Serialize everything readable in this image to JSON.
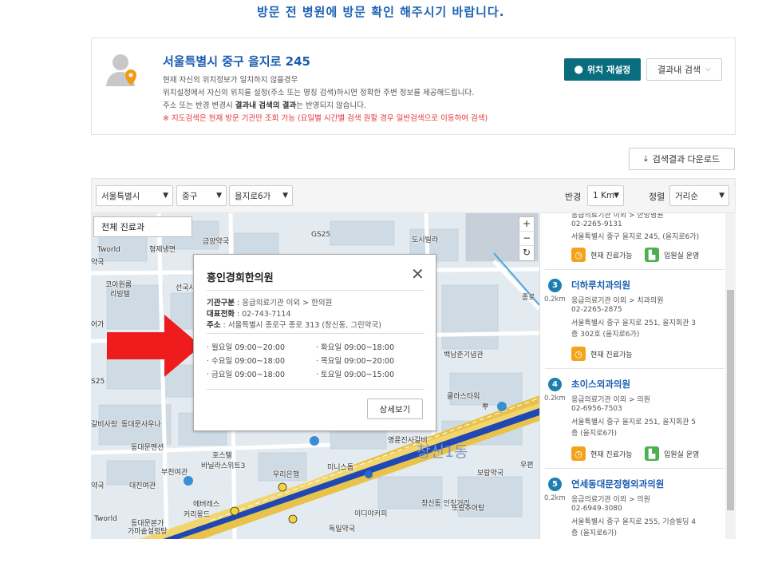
{
  "banner": {
    "text": "방문 전 병원에 방문 확인 해주시기 바랍니다."
  },
  "location": {
    "address": "서울특별시 중구 을지로 245",
    "line1": "현재 자신의 위치정보가 일치하지 않을경우",
    "line2": "위치설정에서 자신의 위치를 설정(주소 또는 명칭 검색)하시면 정확한 주변 정보를 제공해드립니다.",
    "line3_pre": "주소 또는 반경 변경시 ",
    "line3_bold": "결과내 검색의 결과",
    "line3_post": "는 반영되지 않습니다.",
    "warning": "※ 지도검색은 현재 방문 기관만 조회 가능 (요일별 시간별 검색 원할 경우 일반검색으로 이동하여 검색)",
    "reset_label": "위치 재설정",
    "search_within_label": "결과내 검색"
  },
  "download_label": "검색결과 다운로드",
  "filters": {
    "city": "서울특별시",
    "district": "중구",
    "dong": "을지로6가",
    "radius_label": "반경",
    "radius": "1 Km",
    "sort_label": "정렬",
    "sort": "거리순"
  },
  "map": {
    "tab_all": "전체 진료과",
    "zoom_in": "+",
    "zoom_out": "−",
    "refresh": "↻",
    "labels": [
      "금양약국",
      "GS25",
      "도시빌라",
      "형제냉면",
      "Tworld",
      "약국",
      "코아원룸",
      "리빙텔",
      "선국사",
      "어가",
      "S25",
      "갈비사랑",
      "동대문사우나",
      "동대문맨션",
      "호스텔",
      "바닐라스위트3",
      "부천여관",
      "우리은행",
      "대진여관",
      "미니스톱",
      "에버레스",
      "커리몽드",
      "Tworld",
      "동대문본가",
      "가마솥설렁탕",
      "약국",
      "독일약국",
      "이디야커피",
      "창신동 인장거리",
      "또랑추어탕",
      "명륜진사갈비",
      "백남준기념관",
      "클라스타워",
      "종로",
      "창신1동",
      "보람약국",
      "우편",
      "뿌"
    ]
  },
  "popup": {
    "title": "흥인경희한의원",
    "close": "✕",
    "type_label": "기관구분",
    "type_value": " : 응급의료기관 이외 > 한의원",
    "phone_label": "대표전화",
    "phone_value": " : 02-743-7114",
    "addr_label": "주소",
    "addr_value": " : 서울특별시 종로구 종로 313 (창신동, 그린약국)",
    "hours": [
      "· 월요일 09:00~20:00",
      "· 화요일 09:00~18:00",
      "· 수요일 09:00~18:00",
      "· 목요일 09:00~20:00",
      "· 금요일 09:00~18:00",
      "· 토요일 09:00~15:00"
    ],
    "detail_label": "상세보기"
  },
  "results": {
    "first_top_line": "응급의료기관 이외 > 한방병원",
    "first_phone": "02-2265-9131",
    "first_addr": "서울특별시 중구 을지로 245, (을지로6가)",
    "first_badge1": "현재 진료가능",
    "first_badge2": "입원실 운영",
    "items": [
      {
        "num": "3",
        "dist": "0.2km",
        "name": "더하루치과의원",
        "type": "응급의료기관 이외 > 치과의원",
        "phone": "02-2265-2875",
        "addr1": "서울특별시 중구 을지로 251, 을지회관 3",
        "addr2": "층 302호 (을지로6가)",
        "badge1": "현재 진료가능",
        "badge2": ""
      },
      {
        "num": "4",
        "dist": "0.2km",
        "name": "초이스외과의원",
        "type": "응급의료기관 이외 > 의원",
        "phone": "02-6956-7503",
        "addr1": "서울특별시 중구 을지로 251, 을지회관 5",
        "addr2": "층 (을지로6가)",
        "badge1": "현재 진료가능",
        "badge2": "입원실 운영"
      },
      {
        "num": "5",
        "dist": "0.2km",
        "name": "연세동대문정형외과의원",
        "type": "응급의료기관 이외 > 의원",
        "phone": "02-6949-3080",
        "addr1": "서울특별시 중구 을지로 255, 기승빌딩 4",
        "addr2": "층 (을지로6가)",
        "badge1": "",
        "badge2": ""
      }
    ]
  }
}
